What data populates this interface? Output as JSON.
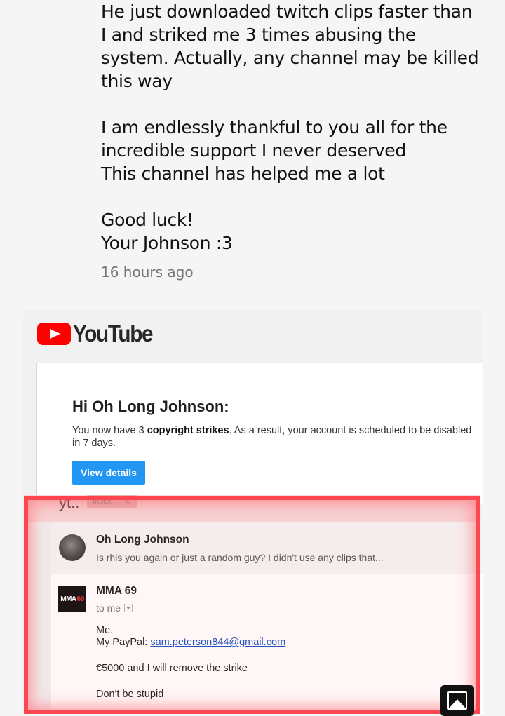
{
  "post": {
    "lines": [
      "He just downloaded twitch clips faster than",
      "I and striked me 3 times abusing the",
      "system. Actually, any channel may be killed",
      "this way",
      "",
      "I am endlessly thankful to you all for the",
      "incredible support I never deserved",
      "This channel has helped me a lot",
      "",
      "Good luck!",
      "Your Johnson :3"
    ],
    "timestamp": "16 hours ago"
  },
  "email": {
    "brand": "YouTube",
    "greeting": "Hi Oh Long Johnson:",
    "notice_pre": "You now have 3 ",
    "notice_bold": "copyright strikes",
    "notice_post": ". As a result, your account is scheduled to be disabled in 7 days.",
    "button_label": "View details"
  },
  "thread": {
    "subject": "yt..",
    "inbox_label": "Inbox",
    "inbox_close": "x",
    "msg1": {
      "sender": "Oh Long Johnson",
      "snippet": "Is rhis you again or just a random guy? I didn't use any clips that..."
    },
    "msg2": {
      "avatar_text_a": "MMA",
      "avatar_text_b": "69",
      "sender": "MMA 69",
      "to": "to me",
      "body_line1": "Me.",
      "paypal_label": "My PayPal: ",
      "paypal_email": "sam.peterson844@gmail.com",
      "offer": "€5000 and I will remove the strike",
      "warning": "Don't be stupid"
    }
  },
  "icons": {
    "image_button": "image-icon"
  },
  "colors": {
    "youtube_red": "#ff0000",
    "button_blue": "#2196f3",
    "highlight_red": "#ff3c46",
    "link_blue": "#1a55c4"
  }
}
